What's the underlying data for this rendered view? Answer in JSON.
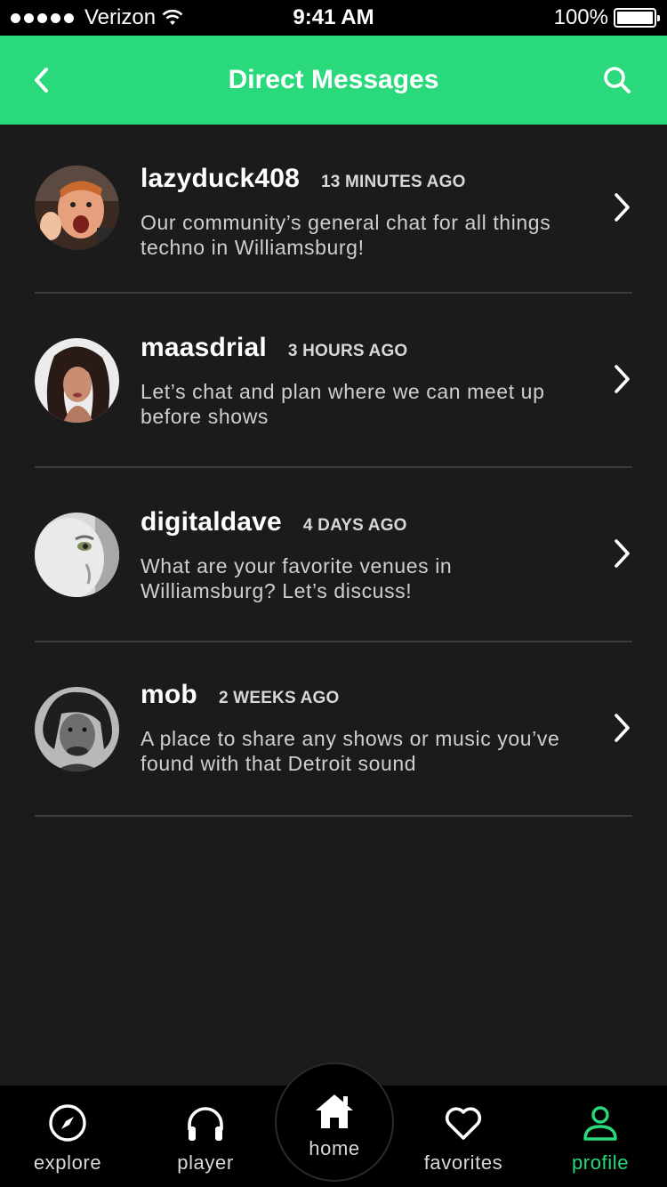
{
  "status_bar": {
    "carrier": "Verizon",
    "time": "9:41 AM",
    "battery": "100%"
  },
  "header": {
    "title": "Direct Messages",
    "back_icon": "chevron-left-icon",
    "search_icon": "search-icon"
  },
  "colors": {
    "accent": "#2ad97c",
    "background": "#1b1b1b",
    "tab_bar": "#000000",
    "divider": "#3c3c3c"
  },
  "messages": [
    {
      "username": "lazyduck408",
      "time": "13 MINUTES AGO",
      "preview": "Our community’s general chat for all things techno in Williamsburg!"
    },
    {
      "username": "maasdrial",
      "time": "3 HOURS AGO",
      "preview": "Let’s chat and plan where we can meet up before shows"
    },
    {
      "username": "digitaldave",
      "time": "4 DAYS AGO",
      "preview": "What are your favorite venues in Williamsburg? Let’s discuss!"
    },
    {
      "username": "mob",
      "time": "2 WEEKS AGO",
      "preview": "A place to share any shows or music you’ve found with that Detroit sound"
    }
  ],
  "tabs": [
    {
      "label": "explore",
      "icon": "compass-icon"
    },
    {
      "label": "player",
      "icon": "headphones-icon"
    },
    {
      "label": "home",
      "icon": "home-icon"
    },
    {
      "label": "favorites",
      "icon": "heart-icon"
    },
    {
      "label": "profile",
      "icon": "user-icon",
      "active": true
    }
  ]
}
